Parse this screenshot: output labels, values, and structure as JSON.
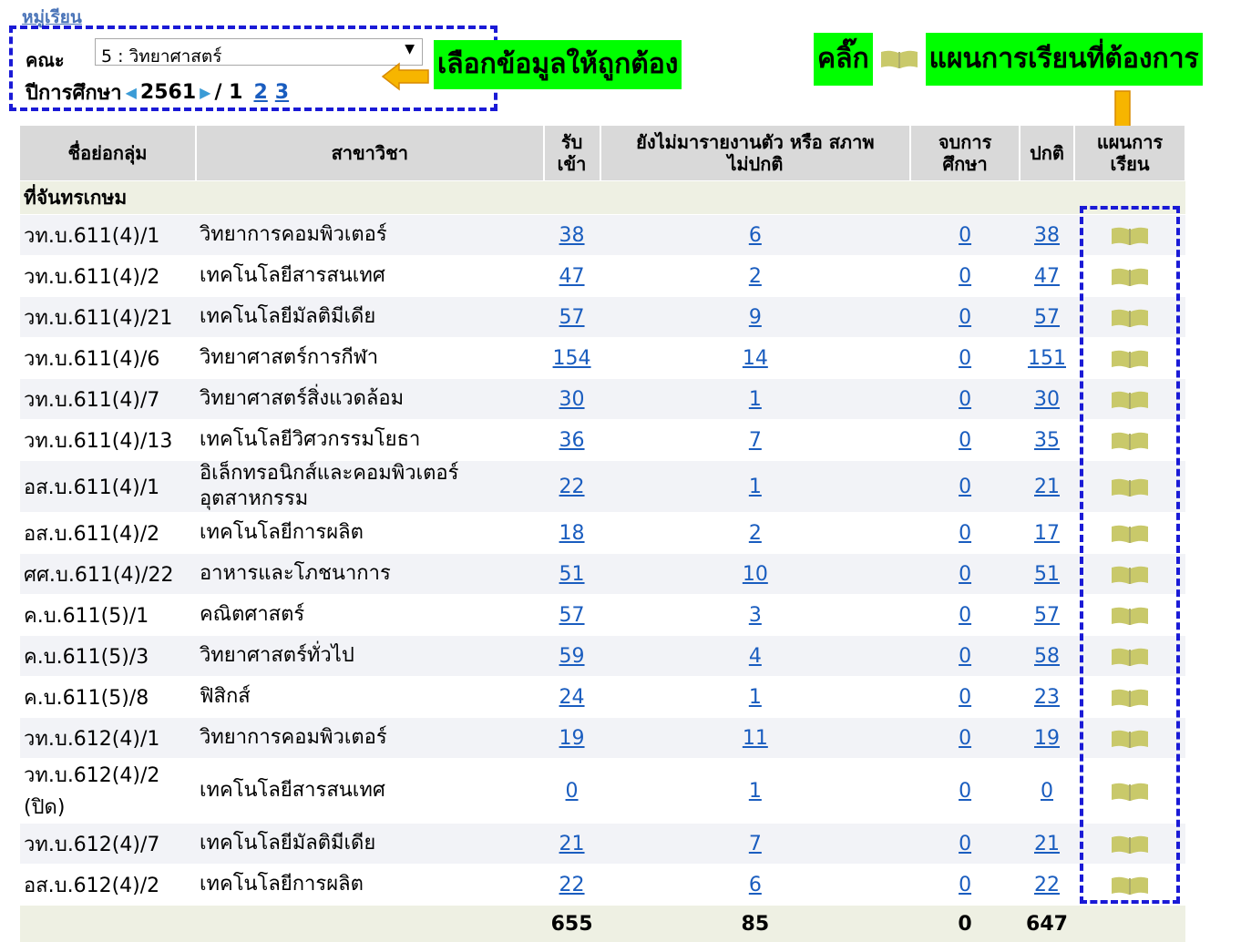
{
  "heading": "หมู่เรียน",
  "filter": {
    "faculty_label": "คณะ",
    "faculty_value": "5 : วิทยาศาสตร์",
    "year_label": "ปีการศึกษา",
    "year_value": "2561",
    "year_sep": "/ 1",
    "pages": [
      "2",
      "3"
    ]
  },
  "callouts": {
    "select_hint": "เลือกข้อมูลให้ถูกต้อง",
    "click_prefix": "คลิ๊ก",
    "click_suffix": "แผนการเรียนที่ต้องการ"
  },
  "table": {
    "headers": {
      "code": "ชื่อย่อกลุ่ม",
      "major": "สาขาวิชา",
      "admitted_1": "รับ",
      "admitted_2": "เข้า",
      "abnormal_1": "ยังไม่มารายงานตัว หรือ สภาพ",
      "abnormal_2": "ไม่ปกติ",
      "graduated_1": "จบการ",
      "graduated_2": "ศึกษา",
      "normal": "ปกติ",
      "plan_1": "แผนการ",
      "plan_2": "เรียน"
    },
    "campus": "ที่จันทรเกษม",
    "rows": [
      {
        "code": "วท.บ.611(4)/1",
        "major": "วิทยาการคอมพิวเตอร์",
        "admitted": "38",
        "abnormal": "6",
        "graduated": "0",
        "normal": "38"
      },
      {
        "code": "วท.บ.611(4)/2",
        "major": "เทคโนโลยีสารสนเทศ",
        "admitted": "47",
        "abnormal": "2",
        "graduated": "0",
        "normal": "47"
      },
      {
        "code": "วท.บ.611(4)/21",
        "major": "เทคโนโลยีมัลติมีเดีย",
        "admitted": "57",
        "abnormal": "9",
        "graduated": "0",
        "normal": "57"
      },
      {
        "code": "วท.บ.611(4)/6",
        "major": "วิทยาศาสตร์การกีฬา",
        "admitted": "154",
        "abnormal": "14",
        "graduated": "0",
        "normal": "151"
      },
      {
        "code": "วท.บ.611(4)/7",
        "major": "วิทยาศาสตร์สิ่งแวดล้อม",
        "admitted": "30",
        "abnormal": "1",
        "graduated": "0",
        "normal": "30"
      },
      {
        "code": "วท.บ.611(4)/13",
        "major": "เทคโนโลยีวิศวกรรมโยธา",
        "admitted": "36",
        "abnormal": "7",
        "graduated": "0",
        "normal": "35"
      },
      {
        "code": "อส.บ.611(4)/1",
        "major": "อิเล็กทรอนิกส์และคอมพิวเตอร์อุตสาหกรรม",
        "admitted": "22",
        "abnormal": "1",
        "graduated": "0",
        "normal": "21"
      },
      {
        "code": "อส.บ.611(4)/2",
        "major": "เทคโนโลยีการผลิต",
        "admitted": "18",
        "abnormal": "2",
        "graduated": "0",
        "normal": "17"
      },
      {
        "code": "ศศ.บ.611(4)/22",
        "major": "อาหารและโภชนาการ",
        "admitted": "51",
        "abnormal": "10",
        "graduated": "0",
        "normal": "51"
      },
      {
        "code": "ค.บ.611(5)/1",
        "major": "คณิตศาสตร์",
        "admitted": "57",
        "abnormal": "3",
        "graduated": "0",
        "normal": "57"
      },
      {
        "code": "ค.บ.611(5)/3",
        "major": "วิทยาศาสตร์ทั่วไป",
        "admitted": "59",
        "abnormal": "4",
        "graduated": "0",
        "normal": "58"
      },
      {
        "code": "ค.บ.611(5)/8",
        "major": "ฟิสิกส์",
        "admitted": "24",
        "abnormal": "1",
        "graduated": "0",
        "normal": "23"
      },
      {
        "code": "วท.บ.612(4)/1",
        "major": "วิทยาการคอมพิวเตอร์",
        "admitted": "19",
        "abnormal": "11",
        "graduated": "0",
        "normal": "19"
      },
      {
        "code": "วท.บ.612(4)/2 (ปิด)",
        "major": "เทคโนโลยีสารสนเทศ",
        "admitted": "0",
        "abnormal": "1",
        "graduated": "0",
        "normal": "0"
      },
      {
        "code": "วท.บ.612(4)/7",
        "major": "เทคโนโลยีมัลติมีเดีย",
        "admitted": "21",
        "abnormal": "7",
        "graduated": "0",
        "normal": "21"
      },
      {
        "code": "อส.บ.612(4)/2",
        "major": "เทคโนโลยีการผลิต",
        "admitted": "22",
        "abnormal": "6",
        "graduated": "0",
        "normal": "22"
      }
    ],
    "totals": {
      "admitted": "655",
      "abnormal": "85",
      "graduated": "0",
      "normal": "647"
    }
  },
  "colors": {
    "highlight": "#00ff00",
    "dash_border": "#1a1ad6",
    "arrow": "#f7b500",
    "link": "#1a5dbf",
    "book_icon": "#c9c96a"
  }
}
